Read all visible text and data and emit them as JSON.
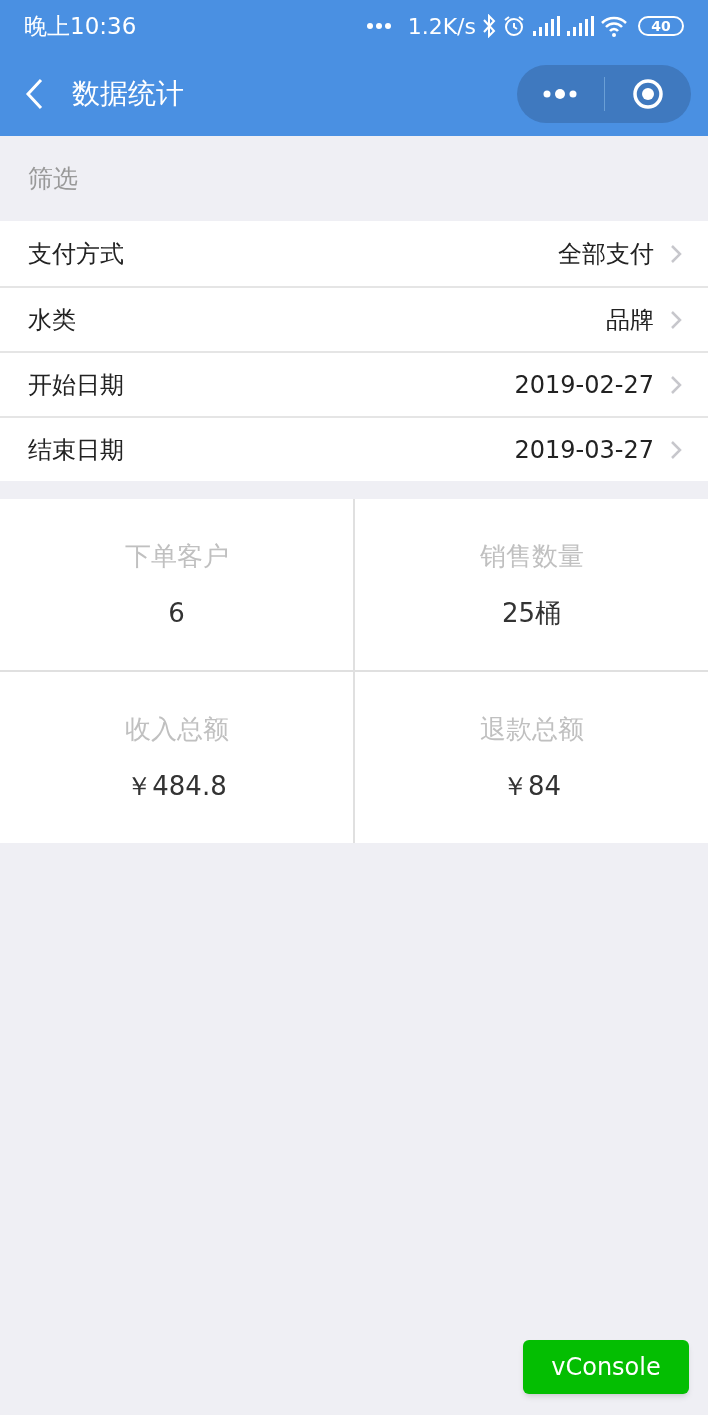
{
  "status_bar": {
    "time": "晚上10:36",
    "speed": "1.2K/s",
    "battery": "40"
  },
  "nav_bar": {
    "title": "数据统计"
  },
  "filter": {
    "header": "筛选",
    "rows": [
      {
        "label": "支付方式",
        "value": "全部支付"
      },
      {
        "label": "水类",
        "value": "品牌"
      },
      {
        "label": "开始日期",
        "value": "2019-02-27"
      },
      {
        "label": "结束日期",
        "value": "2019-03-27"
      }
    ]
  },
  "stats": [
    {
      "label": "下单客户",
      "value": "6"
    },
    {
      "label": "销售数量",
      "value": "25桶"
    },
    {
      "label": "收入总额",
      "value": "￥484.8"
    },
    {
      "label": "退款总额",
      "value": "￥84"
    }
  ],
  "vconsole_button": "vConsole"
}
